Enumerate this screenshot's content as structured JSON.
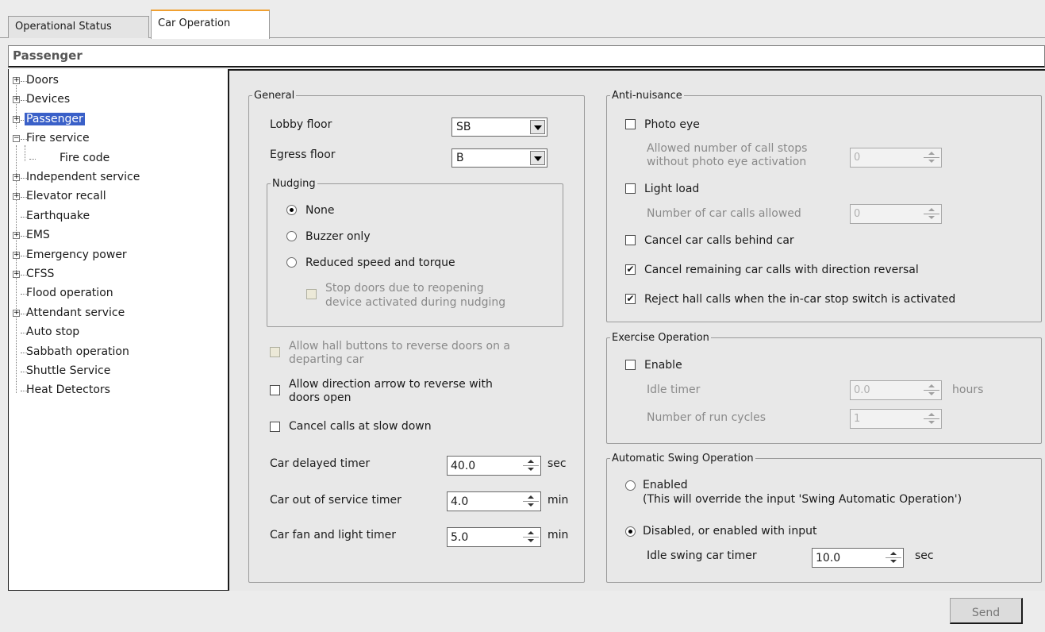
{
  "tabs": [
    "Operational Status",
    "Car Operation"
  ],
  "header": {
    "title": "Passenger"
  },
  "tree": [
    {
      "label": "Doors",
      "expander": "+"
    },
    {
      "label": "Devices",
      "expander": "+"
    },
    {
      "label": "Passenger",
      "expander": "+"
    },
    {
      "label": "Fire service",
      "expander": "−"
    },
    {
      "label": "Fire code",
      "expander": ""
    },
    {
      "label": "Independent service",
      "expander": "+"
    },
    {
      "label": "Elevator recall",
      "expander": "+"
    },
    {
      "label": "Earthquake",
      "expander": ""
    },
    {
      "label": "EMS",
      "expander": "+"
    },
    {
      "label": "Emergency power",
      "expander": "+"
    },
    {
      "label": "CFSS",
      "expander": "+"
    },
    {
      "label": "Flood operation",
      "expander": ""
    },
    {
      "label": "Attendant service",
      "expander": "+"
    },
    {
      "label": "Auto stop",
      "expander": ""
    },
    {
      "label": "Sabbath operation",
      "expander": ""
    },
    {
      "label": "Shuttle Service",
      "expander": ""
    },
    {
      "label": "Heat Detectors",
      "expander": ""
    }
  ],
  "general": {
    "legend": "General",
    "lobby_label": "Lobby floor",
    "lobby_value": "SB",
    "egress_label": "Egress floor",
    "egress_value": "B",
    "nudging": {
      "legend": "Nudging",
      "options": [
        "None",
        "Buzzer only",
        "Reduced speed and torque"
      ],
      "selected": "None",
      "stop_doors_line1": "Stop doors due to reopening",
      "stop_doors_line2": "device activated during nudging"
    },
    "allow_hall_line1": "Allow hall buttons to reverse doors on a",
    "allow_hall_line2": "departing car",
    "allow_dir_line1": "Allow direction arrow to reverse with",
    "allow_dir_line2": "doors open",
    "cancel_slow": "Cancel calls at slow down",
    "timers": [
      {
        "label": "Car delayed timer",
        "value": "40.0",
        "unit": "sec"
      },
      {
        "label": "Car out of service timer",
        "value": "4.0",
        "unit": "min"
      },
      {
        "label": "Car fan and light timer",
        "value": "5.0",
        "unit": "min"
      }
    ]
  },
  "anti_nuisance": {
    "legend": "Anti-nuisance",
    "photo_eye": "Photo eye",
    "photo_eye_checked": false,
    "allowed_stops_line1": "Allowed number of call stops",
    "allowed_stops_line2": "without photo eye activation",
    "allowed_stops_value": "0",
    "light_load": "Light load",
    "light_load_checked": false,
    "car_calls_allowed": "Number of car calls allowed",
    "car_calls_allowed_value": "0",
    "cancel_behind": "Cancel car calls behind car",
    "cancel_behind_checked": false,
    "cancel_remaining": "Cancel remaining car calls with direction reversal",
    "cancel_remaining_checked": true,
    "reject_hall": "Reject hall calls when the in-car stop switch is activated",
    "reject_hall_checked": true
  },
  "exercise": {
    "legend": "Exercise Operation",
    "enable": "Enable",
    "enable_checked": false,
    "idle_timer": "Idle timer",
    "idle_timer_value": "0.0",
    "idle_timer_unit": "hours",
    "run_cycles": "Number of run cycles",
    "run_cycles_value": "1"
  },
  "swing": {
    "legend": "Automatic Swing Operation",
    "enabled": "Enabled",
    "enabled_note": "(This will override the input 'Swing Automatic Operation')",
    "disabled": "Disabled, or enabled with input",
    "selected": "Disabled, or enabled with input",
    "idle_swing": "Idle swing car timer",
    "idle_swing_value": "10.0",
    "idle_swing_unit": "sec"
  },
  "footer": {
    "send_label": "Send"
  }
}
